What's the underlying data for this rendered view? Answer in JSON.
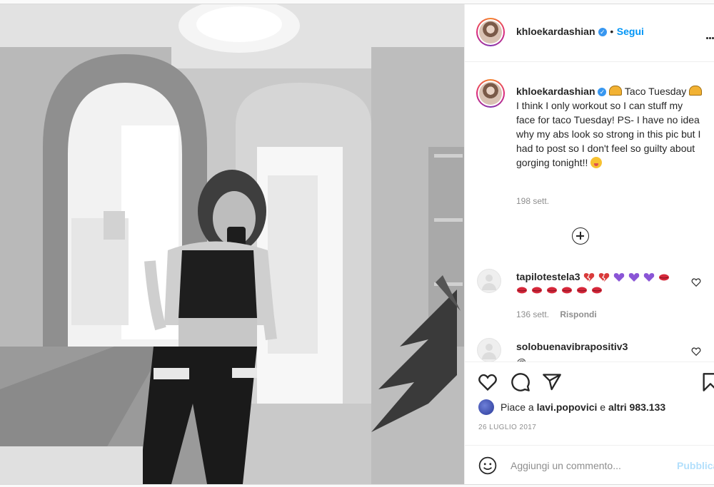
{
  "post": {
    "username": "khloekardashian",
    "follow_label": "Segui",
    "caption": {
      "username": "khloekardashian",
      "text_part1": " Taco Tuesday",
      "text_part2": " I think I only workout so I can stuff my face for taco Tuesday! PS- I have no idea why my abs look so strong in this pic but I had to post so I don't feel so guilty about gorging tonight!! ",
      "time": "198 sett."
    },
    "comments": [
      {
        "username": "tapilotestela3",
        "time": "136 sett.",
        "reply_label": "Rispondi",
        "emojis": [
          "broken-heart",
          "broken-heart",
          "purple-heart",
          "purple-heart",
          "purple-heart",
          "lips",
          "lips",
          "lips",
          "lips",
          "lips",
          "lips",
          "lips",
          "lips"
        ]
      },
      {
        "username": "solobuenavibrapositiv3",
        "text_partial": "@..."
      }
    ],
    "likes": {
      "prefix": "Piace a ",
      "user": "lavi.popovici",
      "middle": " e ",
      "rest": "altri 983.133"
    },
    "date": "26 LUGLIO 2017",
    "add_comment_placeholder": "Aggiungi un commento...",
    "publish_label": "Pubblica"
  },
  "colors": {
    "link": "#0095f6",
    "verified": "#3897f0",
    "muted": "#8e8e8e",
    "text": "#262626",
    "publish_disabled": "#b2dffc"
  },
  "icons": [
    "verified-badge-icon",
    "more-options-icon",
    "add-circle-icon",
    "heart-outline-icon",
    "comment-icon",
    "share-icon",
    "bookmark-icon",
    "emoji-icon"
  ]
}
